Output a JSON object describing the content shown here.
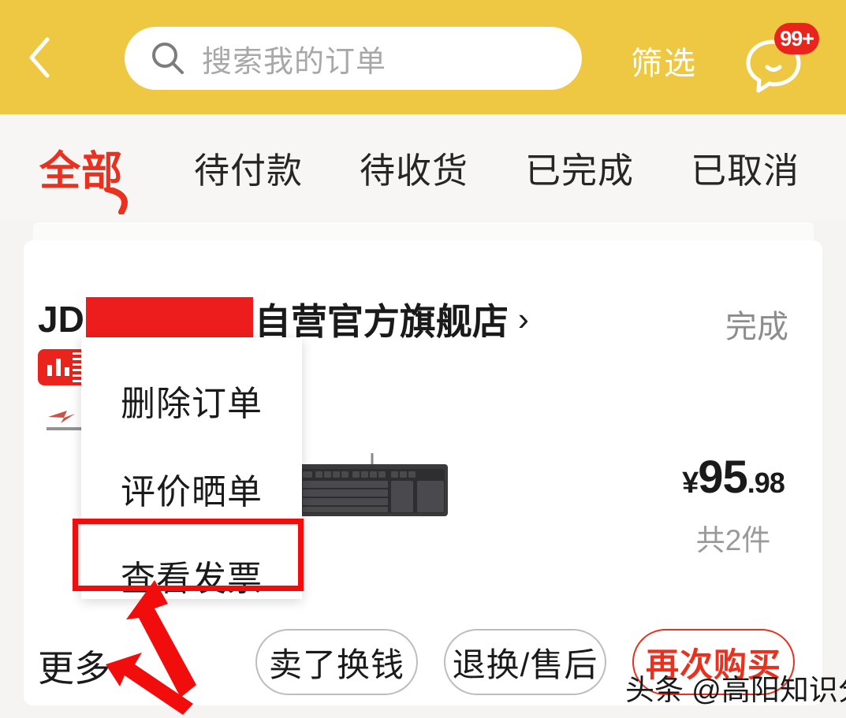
{
  "header": {
    "back_icon": "chevron-left-icon",
    "search": {
      "placeholder": "搜索我的订单",
      "value": "",
      "icon": "search-icon"
    },
    "filter_label": "筛选",
    "chat": {
      "icon": "chat-bubble-icon",
      "badge": "99+"
    },
    "bg_color": "#efc843"
  },
  "tabs": [
    {
      "label": "全部",
      "active": true
    },
    {
      "label": "待付款",
      "active": false
    },
    {
      "label": "待收货",
      "active": false
    },
    {
      "label": "已完成",
      "active": false
    },
    {
      "label": "已取消",
      "active": false
    }
  ],
  "order": {
    "store_prefix": "JD",
    "store_redacted": true,
    "store_suffix": "自营官方旗舰店",
    "store_chevron": "›",
    "status": "完成",
    "price_currency": "¥",
    "price_integer": "95",
    "price_decimal": ".98",
    "quantity": "共2件",
    "product_icon": "keyboard-image",
    "shop_badge_icon": "jd-self-operated-icon"
  },
  "popup_menu": {
    "items": [
      {
        "label": "删除订单",
        "highlighted": false
      },
      {
        "label": "评价晒单",
        "highlighted": false
      },
      {
        "label": "查看发票",
        "highlighted": true
      }
    ]
  },
  "actions": {
    "more_label": "更多",
    "buttons": [
      {
        "label": "卖了换钱",
        "style": "default"
      },
      {
        "label": "退换/售后",
        "style": "default"
      },
      {
        "label": "再次购买",
        "style": "primary"
      }
    ]
  },
  "annotations": {
    "highlight_color": "#f20d0d",
    "arrow_to_invoice": "arrow-up-right-icon",
    "arrow_to_more": "arrow-up-left-icon"
  },
  "watermark": "头条 @高阳知识分享",
  "colors": {
    "header_yellow": "#efc843",
    "accent_red": "#e8321f",
    "badge_red": "#e8241d",
    "page_bg": "#f5f4f2"
  }
}
